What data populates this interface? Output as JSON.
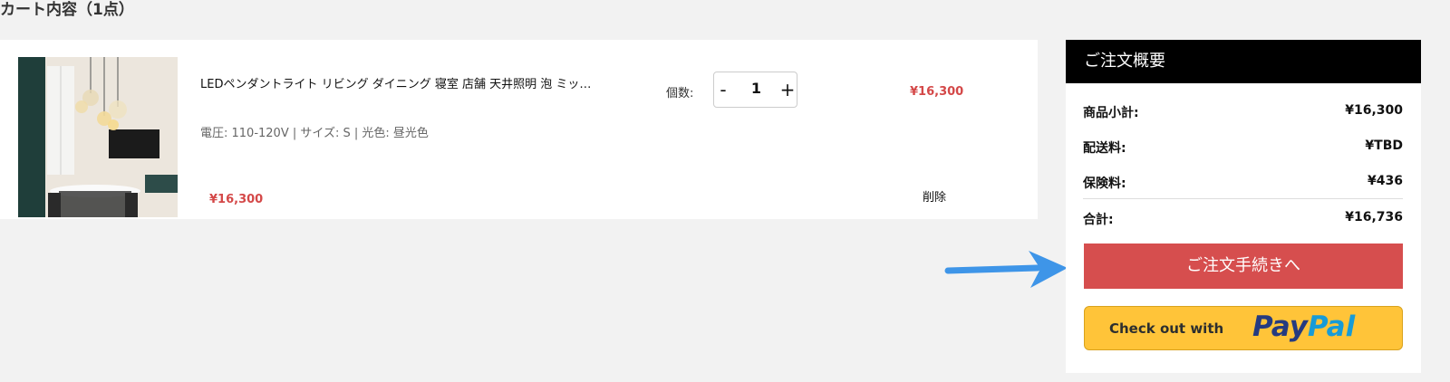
{
  "cart": {
    "title": "カート内容（1点）"
  },
  "item": {
    "name": "LEDペンダントライト リビング ダイニング 寝室 店舗 天井照明 泡 ミッ…",
    "variant": "電圧: 110-120V | サイズ: S | 光色: 昼光色",
    "price_unit": "¥16,300",
    "qty_label": "個数:",
    "qty_minus": "-",
    "qty_value": "1",
    "qty_plus": "+",
    "line_price": "¥16,300",
    "delete_label": "削除"
  },
  "summary": {
    "header": "ご注文概要",
    "rows": [
      {
        "label": "商品小計:",
        "value": "¥16,300"
      },
      {
        "label": "配送料:",
        "value": "¥TBD"
      },
      {
        "label": "保険料:",
        "value": "¥436"
      },
      {
        "label": "合計:",
        "value": "¥16,736"
      }
    ],
    "checkout_label": "ご注文手続きへ",
    "paypal_prefix": "Check out with",
    "paypal_brand_a": "Pay",
    "paypal_brand_b": "Pal"
  },
  "colors": {
    "price_red": "#d44848",
    "checkout_red": "#d64e4e",
    "paypal_yellow": "#ffc439",
    "arrow_blue": "#3e95e8"
  }
}
